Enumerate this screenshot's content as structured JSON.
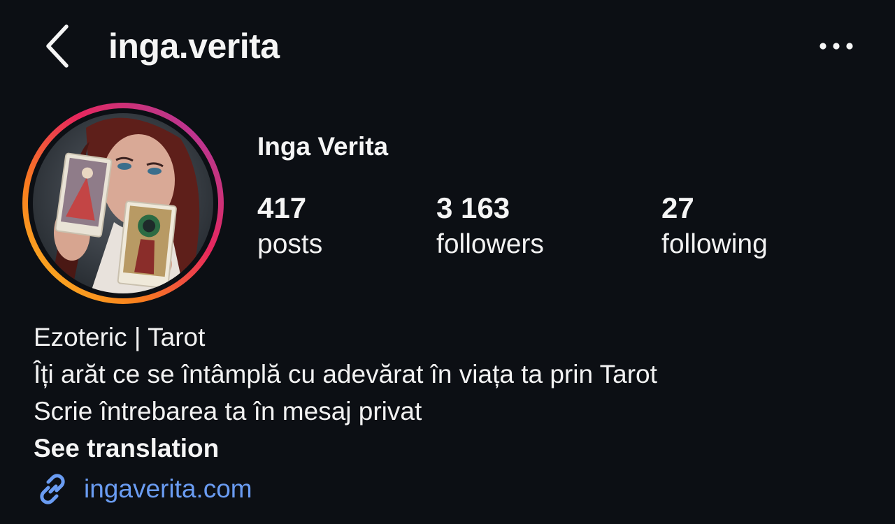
{
  "header": {
    "username": "inga.verita",
    "back_icon": "chevron-left-icon",
    "more_icon": "more-horizontal-icon"
  },
  "profile": {
    "display_name": "Inga Verita",
    "avatar": "profile-photo-with-story-ring",
    "ring_colors": [
      "#f9c423",
      "#fa7e1e",
      "#e8275d",
      "#c13584",
      "#b82bd1"
    ]
  },
  "stats": [
    {
      "value": "417",
      "label": "posts"
    },
    {
      "value": "3 163",
      "label": "followers"
    },
    {
      "value": "27",
      "label": "following"
    }
  ],
  "bio": {
    "lines": [
      "Ezoteric | Tarot",
      "Îți arăt ce se întâmplă cu adevărat în viața ta prin Tarot",
      "Scrie întrebarea ta în mesaj privat"
    ],
    "translate_label": "See translation"
  },
  "link": {
    "icon": "link-icon",
    "text": "ingaverita.com",
    "color": "#6a9cf2"
  },
  "colors": {
    "background": "#0c0f14",
    "text": "#f5f5f5"
  }
}
